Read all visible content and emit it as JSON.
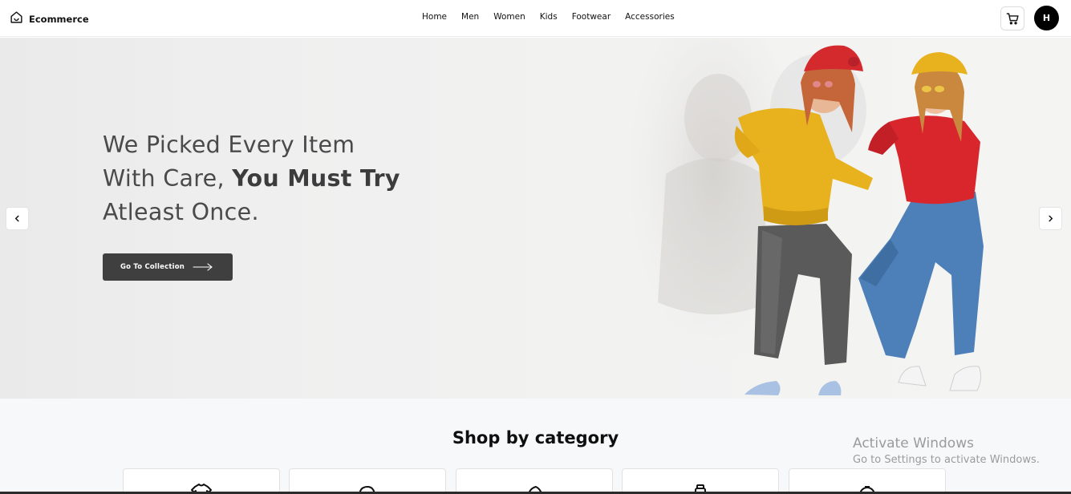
{
  "brand": {
    "name": "Ecommerce"
  },
  "nav": {
    "links": [
      "Home",
      "Men",
      "Women",
      "Kids",
      "Footwear",
      "Accessories"
    ]
  },
  "header": {
    "avatar_initial": "H",
    "cart_icon": "cart-icon"
  },
  "hero": {
    "headline_line1": "We Picked Every Item",
    "headline_line2_regular": "With Care, ",
    "headline_line2_bold": "You Must Try",
    "headline_line3": "Atleast Once.",
    "cta_label": "Go To Collection"
  },
  "categories": {
    "title": "Shop by category",
    "items": [
      "shirt-icon",
      "cap-icon",
      "shoe-icon",
      "bottle-icon",
      "watch-icon"
    ]
  },
  "watermark": {
    "title": "Activate Windows",
    "subtitle": "Go to Settings to activate Windows."
  },
  "colors": {
    "cta_background": "#3e3f3e",
    "avatar_background": "#000000",
    "hat_red": "#d42a2e",
    "sweater_yellow": "#e8b21f",
    "sweater_red": "#d9262d",
    "denim_blue": "#4d7fb8",
    "jeans_grey": "#5a5a5a"
  }
}
